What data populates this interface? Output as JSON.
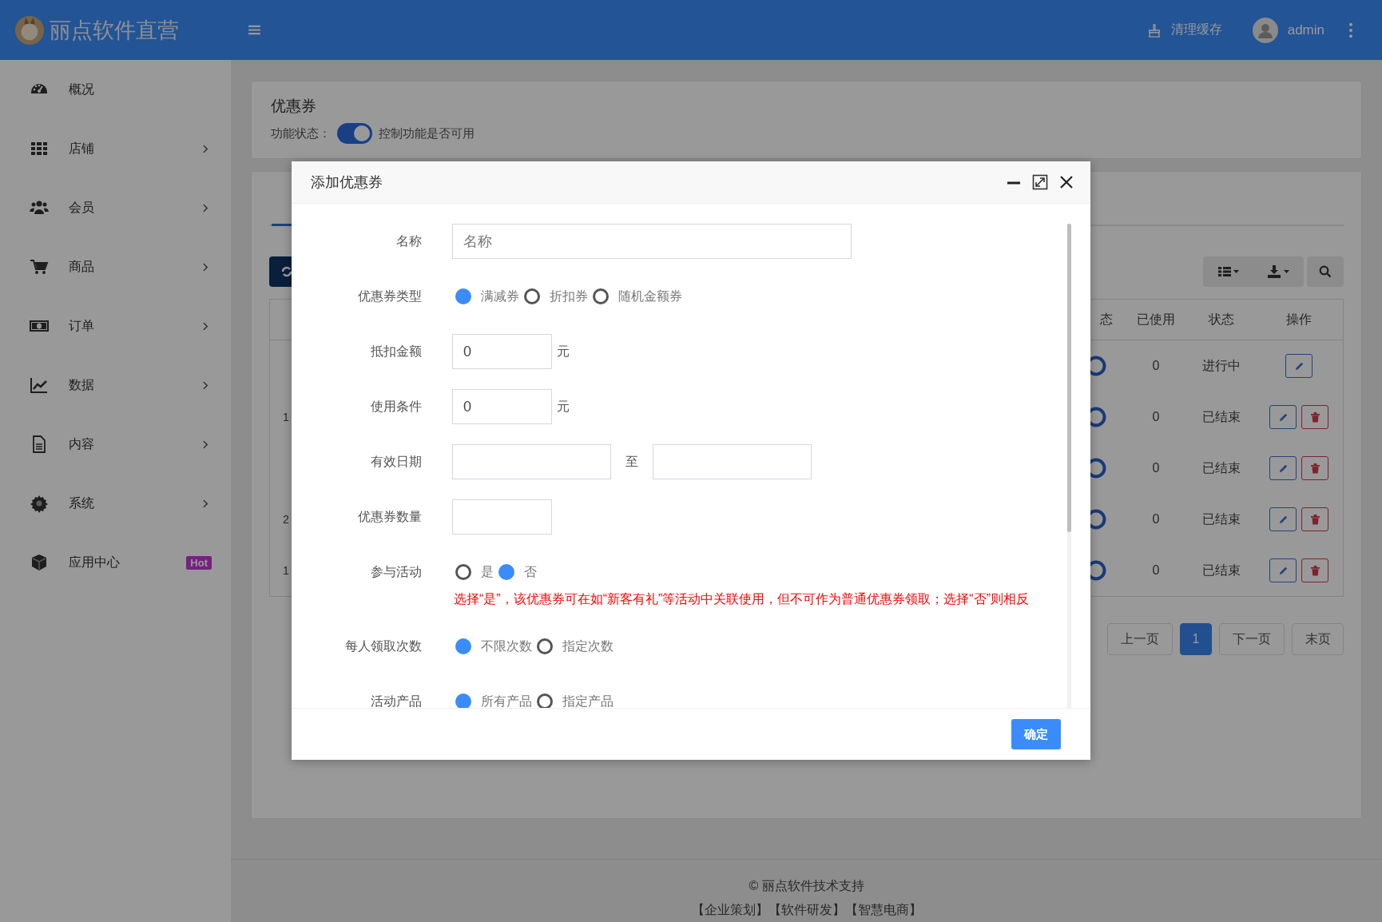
{
  "topbar": {
    "brand": "丽点软件直营",
    "cache_button": "清理缓存",
    "user": "admin"
  },
  "sidebar": {
    "items": [
      {
        "label": "概况",
        "expandable": false
      },
      {
        "label": "店铺",
        "expandable": true
      },
      {
        "label": "会员",
        "expandable": true
      },
      {
        "label": "商品",
        "expandable": true
      },
      {
        "label": "订单",
        "expandable": true
      },
      {
        "label": "数据",
        "expandable": true
      },
      {
        "label": "内容",
        "expandable": true
      },
      {
        "label": "系统",
        "expandable": true
      },
      {
        "label": "应用中心",
        "expandable": false,
        "badge": "Hot"
      }
    ]
  },
  "feature_card": {
    "title": "优惠券",
    "status_label": "功能状态：",
    "switch_on": true,
    "hint": "控制功能是否可用"
  },
  "table": {
    "columns": [
      "态",
      "已使用",
      "状态",
      "操作"
    ],
    "rows": [
      {
        "column_1": "",
        "used": "0",
        "status": "进行中",
        "deletable": false
      },
      {
        "column_1": "1",
        "used": "0",
        "status": "已结束",
        "deletable": true
      },
      {
        "column_1": "",
        "used": "0",
        "status": "已结束",
        "deletable": true
      },
      {
        "column_1": "2",
        "used": "0",
        "status": "已结束",
        "deletable": true
      },
      {
        "column_1": "1",
        "used": "0",
        "status": "已结束",
        "deletable": true
      }
    ]
  },
  "pagination": [
    {
      "label": "上一页",
      "selected": false
    },
    {
      "label": "1",
      "selected": true
    },
    {
      "label": "下一页",
      "selected": false
    },
    {
      "label": "末页",
      "selected": false
    }
  ],
  "modal": {
    "title": "添加优惠券",
    "fields": [
      {
        "kind": "text",
        "label": "名称",
        "placeholder": "名称"
      },
      {
        "kind": "radio",
        "label": "优惠券类型",
        "options": [
          {
            "label": "满减券",
            "selected": true
          },
          {
            "label": "折扣券",
            "selected": false
          },
          {
            "label": "随机金额券",
            "selected": false
          }
        ]
      },
      {
        "kind": "amount",
        "label": "抵扣金额",
        "value": "0",
        "unit": "元"
      },
      {
        "kind": "amount",
        "label": "使用条件",
        "value": "0",
        "unit": "元"
      },
      {
        "kind": "daterange",
        "label": "有效日期",
        "separator": "至"
      },
      {
        "kind": "number",
        "label": "优惠券数量"
      },
      {
        "kind": "radio",
        "label": "参与活动",
        "options": [
          {
            "label": "是",
            "selected": false
          },
          {
            "label": "否",
            "selected": true
          }
        ],
        "note": "选择“是”，该优惠券可在如“新客有礼”等活动中关联使用，但不可作为普通优惠券领取；选择“否”则相反"
      },
      {
        "kind": "radio",
        "label": "每人领取次数",
        "options": [
          {
            "label": "不限次数",
            "selected": true
          },
          {
            "label": "指定次数",
            "selected": false
          }
        ]
      },
      {
        "kind": "radio",
        "label": "活动产品",
        "options": [
          {
            "label": "所有产品",
            "selected": true
          },
          {
            "label": "指定产品",
            "selected": false
          }
        ]
      }
    ],
    "confirm": "确定"
  },
  "footer": {
    "copyright": "© 丽点软件技术支持",
    "links": "【企业策划】【软件研发】【智慧电商】"
  }
}
